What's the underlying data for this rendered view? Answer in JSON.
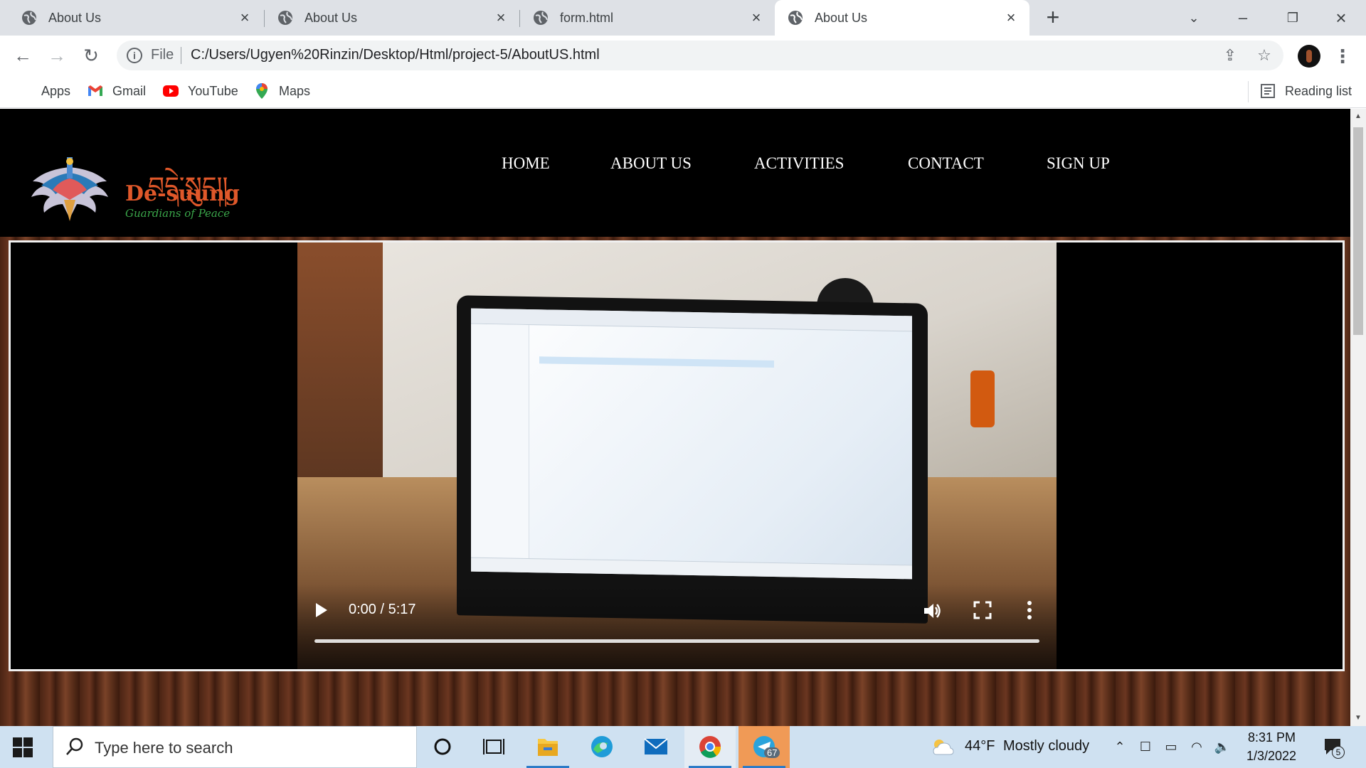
{
  "browser": {
    "tabs": [
      {
        "title": "About Us",
        "active": false
      },
      {
        "title": "About Us",
        "active": false
      },
      {
        "title": "form.html",
        "active": false
      },
      {
        "title": "About Us",
        "active": true
      }
    ],
    "new_tab_label": "+",
    "address": {
      "scheme_label": "File",
      "url": "C:/Users/Ugyen%20Rinzin/Desktop/Html/project-5/AboutUS.html"
    },
    "bookmarks": [
      {
        "label": "Apps",
        "icon": "apps-grid-icon"
      },
      {
        "label": "Gmail",
        "icon": "gmail-icon"
      },
      {
        "label": "YouTube",
        "icon": "youtube-icon"
      },
      {
        "label": "Maps",
        "icon": "maps-pin-icon"
      }
    ],
    "reading_list_label": "Reading list"
  },
  "site": {
    "logo": {
      "tibetan": "བདེ་སྲུང།།",
      "name": "De-suung",
      "tagline": "Guardians of Peace"
    },
    "nav": [
      {
        "label": "HOME"
      },
      {
        "label": "ABOUT US"
      },
      {
        "label": "ACTIVITIES"
      },
      {
        "label": "CONTACT"
      },
      {
        "label": "SIGN UP"
      }
    ],
    "video": {
      "time": "0:00 / 5:17",
      "progress": 0
    }
  },
  "taskbar": {
    "search_placeholder": "Type here to search",
    "apps": [
      "cortana-icon",
      "task-view-icon",
      "file-explorer-icon",
      "edge-icon",
      "mail-icon",
      "chrome-icon",
      "telegram-icon"
    ],
    "telegram_badge": "67",
    "weather": {
      "temp": "44°F",
      "condition": "Mostly cloudy"
    },
    "clock": {
      "time": "8:31 PM",
      "date": "1/3/2022"
    },
    "notification_count": "5"
  },
  "colors": {
    "accent": "#e0582a",
    "tagline": "#3aa64a",
    "taskbar": "#cfe1f1",
    "tabstrip": "#dee1e6"
  }
}
